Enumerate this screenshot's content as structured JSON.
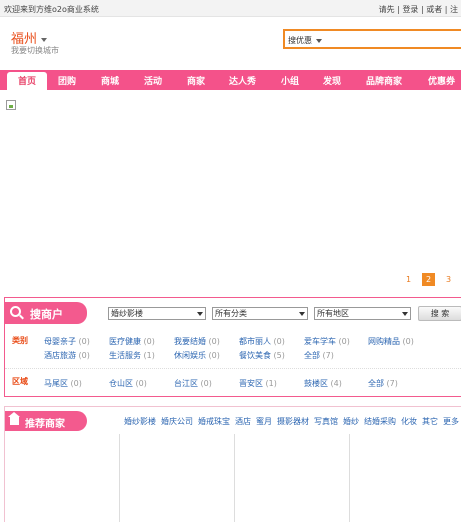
{
  "topbar": {
    "welcome": "欢迎来到方维o2o商业系统",
    "login_prompt": "请先",
    "login": "登录",
    "or": "或者",
    "register": "注"
  },
  "city": {
    "name": "福州",
    "switch_label": "我要切换城市"
  },
  "search": {
    "scope": "搜优惠"
  },
  "nav": {
    "items": [
      "首页",
      "团购",
      "商城",
      "活动",
      "商家",
      "达人秀",
      "小组",
      "发现",
      "品牌商家",
      "优惠券"
    ]
  },
  "pager": {
    "pages": [
      "1",
      "2",
      "3"
    ],
    "current": "2"
  },
  "shop_search": {
    "title": "搜商户",
    "filters": [
      "婚纱影楼",
      "所有分类",
      "所有地区"
    ],
    "search_button": "搜 索",
    "category_label": "类别",
    "categories": [
      {
        "name": "母婴亲子",
        "count": "(0)"
      },
      {
        "name": "医疗健康",
        "count": "(0)"
      },
      {
        "name": "我要结婚",
        "count": "(0)"
      },
      {
        "name": "都市丽人",
        "count": "(0)"
      },
      {
        "name": "爱车学车",
        "count": "(0)"
      },
      {
        "name": "网购精品",
        "count": "(0)"
      },
      {
        "name": "酒店旅游",
        "count": "(0)"
      },
      {
        "name": "生活服务",
        "count": "(1)"
      },
      {
        "name": "休闲娱乐",
        "count": "(0)"
      },
      {
        "name": "餐饮美食",
        "count": "(5)"
      },
      {
        "name": "全部",
        "count": "(7)"
      }
    ],
    "region_label": "区域",
    "regions": [
      {
        "name": "马尾区",
        "count": "(0)"
      },
      {
        "name": "仓山区",
        "count": "(0)"
      },
      {
        "name": "台江区",
        "count": "(0)"
      },
      {
        "name": "晋安区",
        "count": "(1)"
      },
      {
        "name": "鼓楼区",
        "count": "(4)"
      },
      {
        "name": "全部",
        "count": "(7)"
      }
    ]
  },
  "recommend": {
    "title": "推荐商家",
    "categories": [
      "婚纱影楼",
      "婚庆公司",
      "婚戒珠宝",
      "酒店",
      "蜜月",
      "摄影器材",
      "写真馆",
      "婚纱",
      "结婚采购",
      "化妆",
      "其它",
      "更多"
    ]
  },
  "colors": {
    "nav_pink": "#f4528a",
    "accent_orange": "#f08a24",
    "link_blue": "#2e67b2",
    "label_red": "#e94c18"
  }
}
